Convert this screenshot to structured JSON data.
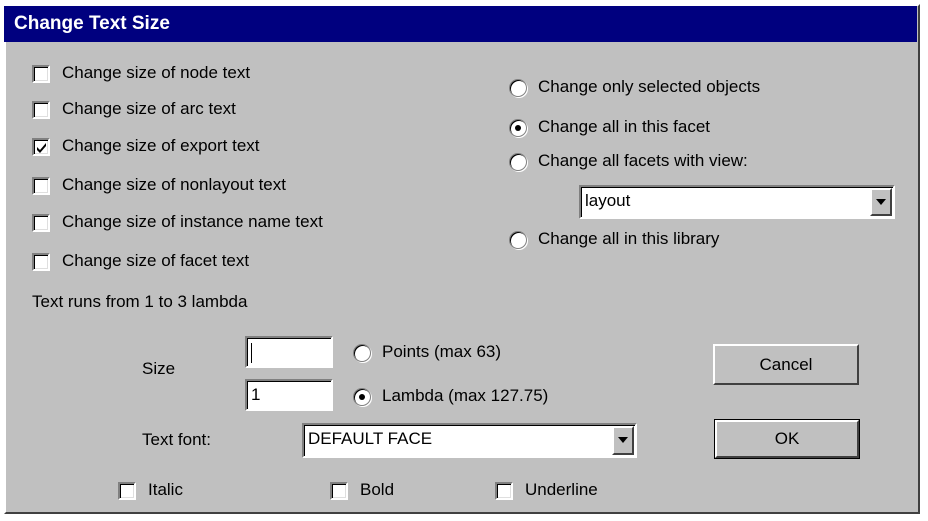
{
  "title": "Change Text Size",
  "checkboxes": [
    {
      "label": "Change size of node text",
      "checked": false
    },
    {
      "label": "Change size of arc text",
      "checked": false
    },
    {
      "label": "Change size of export text",
      "checked": true
    },
    {
      "label": "Change size of nonlayout text",
      "checked": false
    },
    {
      "label": "Change size of instance name text",
      "checked": false
    },
    {
      "label": "Change size of facet text",
      "checked": false
    }
  ],
  "scope": {
    "options": [
      {
        "label": "Change only selected objects",
        "selected": false
      },
      {
        "label": "Change all in this facet",
        "selected": true
      },
      {
        "label": "Change all facets with view:",
        "selected": false
      },
      {
        "label": "Change all in this library",
        "selected": false
      }
    ],
    "view_select_value": "layout"
  },
  "info_text": "Text runs from 1 to 3 lambda",
  "size": {
    "label": "Size",
    "points_value": "",
    "points_label": "Points (max 63)",
    "points_selected": false,
    "lambda_value": "1",
    "lambda_label": "Lambda (max 127.75)",
    "lambda_selected": true
  },
  "font": {
    "label": "Text font:",
    "value": "DEFAULT FACE"
  },
  "styles": {
    "italic_label": "Italic",
    "italic_checked": false,
    "bold_label": "Bold",
    "bold_checked": false,
    "underline_label": "Underline",
    "underline_checked": false
  },
  "buttons": {
    "cancel": "Cancel",
    "ok": "OK"
  }
}
